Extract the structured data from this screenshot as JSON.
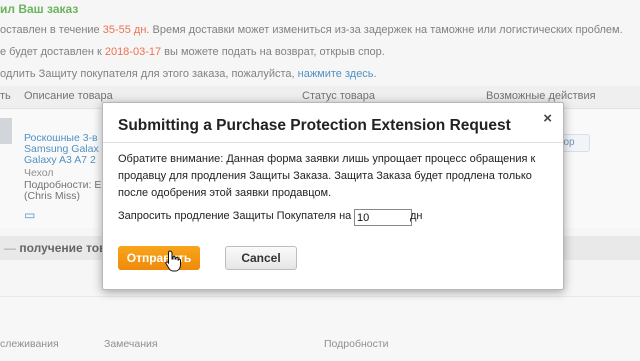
{
  "background": {
    "heading": "ил Ваш заказ",
    "delivery": {
      "prefix": "оставлен в течение ",
      "days": "35-55 дн",
      "suffix": ". Время доставки может измениться из-за задержек на таможне или логистических проблем."
    },
    "delivered": {
      "prefix": "е будет доставлен к ",
      "date": "2018-03-17",
      "suffix": " вы можете подать на возврат, открыв спор."
    },
    "extend": {
      "prefix": "одлить Защиту покупателя для этого заказа, пожалуйста, ",
      "link": "нажмите здесь",
      "suffix": "."
    },
    "table_headers": [
      "ть",
      "Описание товара",
      "Статус товара",
      "Возможные действия"
    ],
    "product_lines": [
      "Роскошные 3-в",
      "Samsung Galax",
      "Galaxy A3 A7 2",
      "Чехол",
      "Подробности: E",
      "(Chris Miss)"
    ],
    "ghost_button": "ор",
    "receiving": "получение това",
    "footer_links": [
      "слеживания",
      "Замечания",
      "Подробности"
    ]
  },
  "modal": {
    "title": "Submitting a Purchase Protection Extension Request",
    "close": "×",
    "notice": "Обратите внимание: Данная форма заявки лишь упрощает процесс обращения к продавцу для продления Защиты Заказа. Защита Заказа будет продлена только после одобрения этой заявки продавцом.",
    "request_label": "Запросить продление Защиты Покупателя на",
    "request_value": "10",
    "request_unit": "дн",
    "send_label": "Отправить",
    "cancel_label": "Cancel"
  }
}
